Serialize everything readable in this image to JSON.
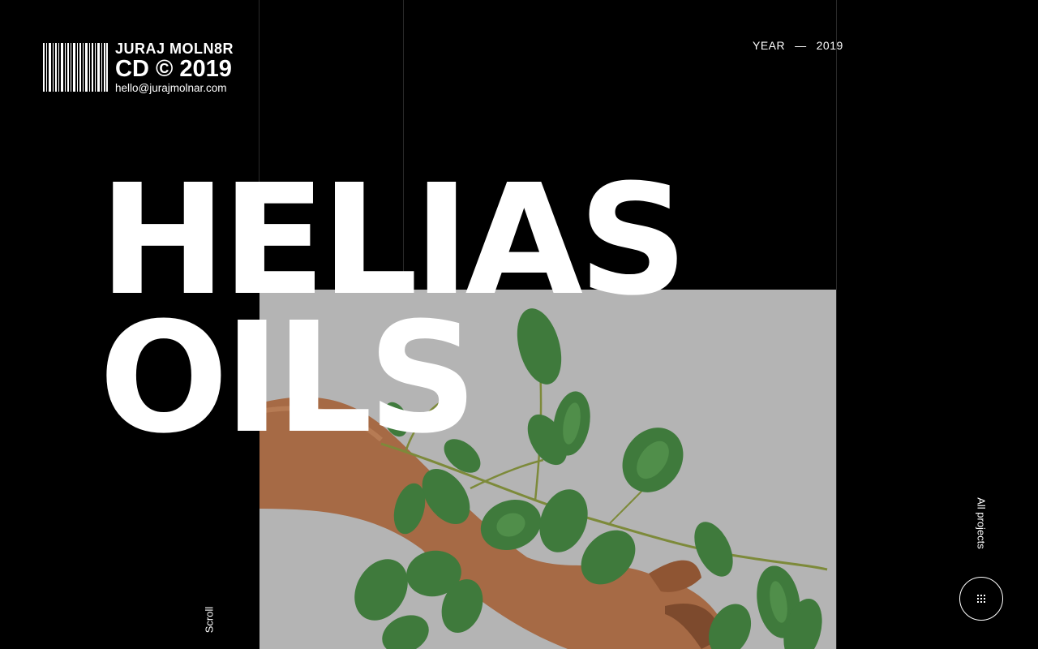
{
  "brand": {
    "name": "JURAJ MOLN8R",
    "copyright": "CD © 2019",
    "email": "hello@jurajmolnar.com"
  },
  "year": {
    "label": "YEAR",
    "dash": "—",
    "value": "2019"
  },
  "project": {
    "title": "HELIAS\nOILS"
  },
  "nav": {
    "scroll_label": "Scroll",
    "all_projects_label": "All projects"
  },
  "icons": {
    "barcode": "barcode-logo",
    "menu": "grid-dots-icon"
  },
  "colors": {
    "background": "#000000",
    "text": "#ffffff",
    "photo_bg": "#b4b4b4",
    "leaf": "#3f7a3c",
    "skin": "#a66a45"
  }
}
